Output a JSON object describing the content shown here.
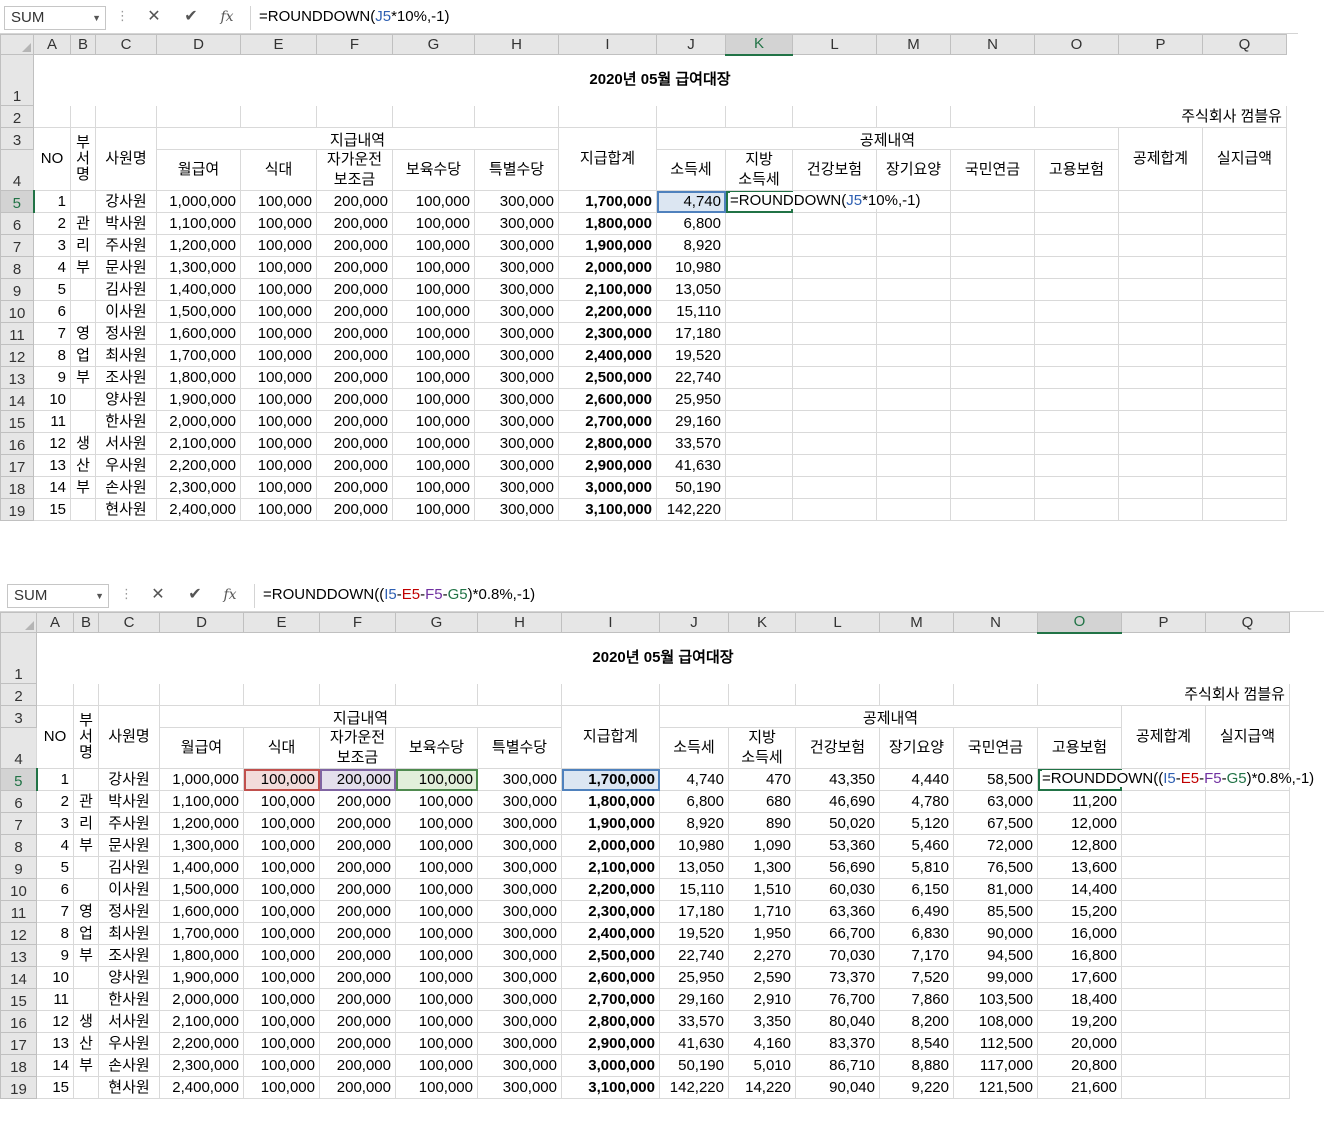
{
  "top": {
    "name_box": "SUM",
    "formula": [
      "=ROUNDDOWN(",
      "J5",
      "*10%,-1)"
    ],
    "cell_formula": [
      "=ROUNDDOWN(",
      "J5",
      "*10%,-1)"
    ]
  },
  "bottom": {
    "name_box": "SUM",
    "formula": [
      "=ROUNDDOWN((",
      "I5",
      "-",
      "E5",
      "-",
      "F5",
      "-",
      "G5",
      ")*0.8%,-1)"
    ],
    "cell_formula": [
      "=ROUNDDOWN((",
      "I5",
      "-",
      "E5",
      "-",
      "F5",
      "-",
      "G5",
      ")*0.8%,-1)"
    ]
  },
  "toolbar": {
    "cancel": "✕",
    "enter": "✔",
    "fx": "fx",
    "dots": "⋮"
  },
  "columns": [
    "A",
    "B",
    "C",
    "D",
    "E",
    "F",
    "G",
    "H",
    "I",
    "J",
    "K",
    "L",
    "M",
    "N",
    "O",
    "P",
    "Q"
  ],
  "sheet": {
    "title": "2020년 05월 급여대장",
    "company": "주식회사 껌블유",
    "group_pay": "지급내역",
    "group_deduct": "공제내역",
    "h_no": "NO",
    "h_dept": [
      "부",
      "서",
      "명"
    ],
    "h_name": "사원명",
    "h_salary": "월급여",
    "h_meal": "식대",
    "h_car": [
      "자가운전",
      "보조금"
    ],
    "h_child": "보육수당",
    "h_special": "특별수당",
    "h_total": "지급합계",
    "h_tax": "소득세",
    "h_local": [
      "지방",
      "소득세"
    ],
    "h_health": "건강보험",
    "h_ltc": "장기요양",
    "h_pension": "국민연금",
    "h_employ": "고용보험",
    "h_deduct_total": "공제합계",
    "h_net": "실지급액",
    "dept_chars": {
      "6": "관",
      "7": "리",
      "8": "부",
      "11": "영",
      "12": "업",
      "13": "부",
      "16": "생",
      "17": "산",
      "18": "부"
    },
    "rows": [
      {
        "no": "1",
        "name": "강사원",
        "salary": "1,000,000",
        "total": "1,700,000",
        "tax": "4,740",
        "local": "470",
        "health": "43,350",
        "ltc": "4,440",
        "pension": "58,500",
        "employ": ""
      },
      {
        "no": "2",
        "name": "박사원",
        "salary": "1,100,000",
        "total": "1,800,000",
        "tax": "6,800",
        "local": "680",
        "health": "46,690",
        "ltc": "4,780",
        "pension": "63,000",
        "employ": "11,200"
      },
      {
        "no": "3",
        "name": "주사원",
        "salary": "1,200,000",
        "total": "1,900,000",
        "tax": "8,920",
        "local": "890",
        "health": "50,020",
        "ltc": "5,120",
        "pension": "67,500",
        "employ": "12,000"
      },
      {
        "no": "4",
        "name": "문사원",
        "salary": "1,300,000",
        "total": "2,000,000",
        "tax": "10,980",
        "local": "1,090",
        "health": "53,360",
        "ltc": "5,460",
        "pension": "72,000",
        "employ": "12,800"
      },
      {
        "no": "5",
        "name": "김사원",
        "salary": "1,400,000",
        "total": "2,100,000",
        "tax": "13,050",
        "local": "1,300",
        "health": "56,690",
        "ltc": "5,810",
        "pension": "76,500",
        "employ": "13,600"
      },
      {
        "no": "6",
        "name": "이사원",
        "salary": "1,500,000",
        "total": "2,200,000",
        "tax": "15,110",
        "local": "1,510",
        "health": "60,030",
        "ltc": "6,150",
        "pension": "81,000",
        "employ": "14,400"
      },
      {
        "no": "7",
        "name": "정사원",
        "salary": "1,600,000",
        "total": "2,300,000",
        "tax": "17,180",
        "local": "1,710",
        "health": "63,360",
        "ltc": "6,490",
        "pension": "85,500",
        "employ": "15,200"
      },
      {
        "no": "8",
        "name": "최사원",
        "salary": "1,700,000",
        "total": "2,400,000",
        "tax": "19,520",
        "local": "1,950",
        "health": "66,700",
        "ltc": "6,830",
        "pension": "90,000",
        "employ": "16,000"
      },
      {
        "no": "9",
        "name": "조사원",
        "salary": "1,800,000",
        "total": "2,500,000",
        "tax": "22,740",
        "local": "2,270",
        "health": "70,030",
        "ltc": "7,170",
        "pension": "94,500",
        "employ": "16,800"
      },
      {
        "no": "10",
        "name": "양사원",
        "salary": "1,900,000",
        "total": "2,600,000",
        "tax": "25,950",
        "local": "2,590",
        "health": "73,370",
        "ltc": "7,520",
        "pension": "99,000",
        "employ": "17,600"
      },
      {
        "no": "11",
        "name": "한사원",
        "salary": "2,000,000",
        "total": "2,700,000",
        "tax": "29,160",
        "local": "2,910",
        "health": "76,700",
        "ltc": "7,860",
        "pension": "103,500",
        "employ": "18,400"
      },
      {
        "no": "12",
        "name": "서사원",
        "salary": "2,100,000",
        "total": "2,800,000",
        "tax": "33,570",
        "local": "3,350",
        "health": "80,040",
        "ltc": "8,200",
        "pension": "108,000",
        "employ": "19,200"
      },
      {
        "no": "13",
        "name": "우사원",
        "salary": "2,200,000",
        "total": "2,900,000",
        "tax": "41,630",
        "local": "4,160",
        "health": "83,370",
        "ltc": "8,540",
        "pension": "112,500",
        "employ": "20,000"
      },
      {
        "no": "14",
        "name": "손사원",
        "salary": "2,300,000",
        "total": "3,000,000",
        "tax": "50,190",
        "local": "5,010",
        "health": "86,710",
        "ltc": "8,880",
        "pension": "117,000",
        "employ": "20,800"
      },
      {
        "no": "15",
        "name": "현사원",
        "salary": "2,400,000",
        "total": "3,100,000",
        "tax": "142,220",
        "local": "14,220",
        "health": "90,040",
        "ltc": "9,220",
        "pension": "121,500",
        "employ": "21,600"
      }
    ],
    "meal": "100,000",
    "car": "200,000",
    "child": "100,000",
    "special": "300,000"
  }
}
